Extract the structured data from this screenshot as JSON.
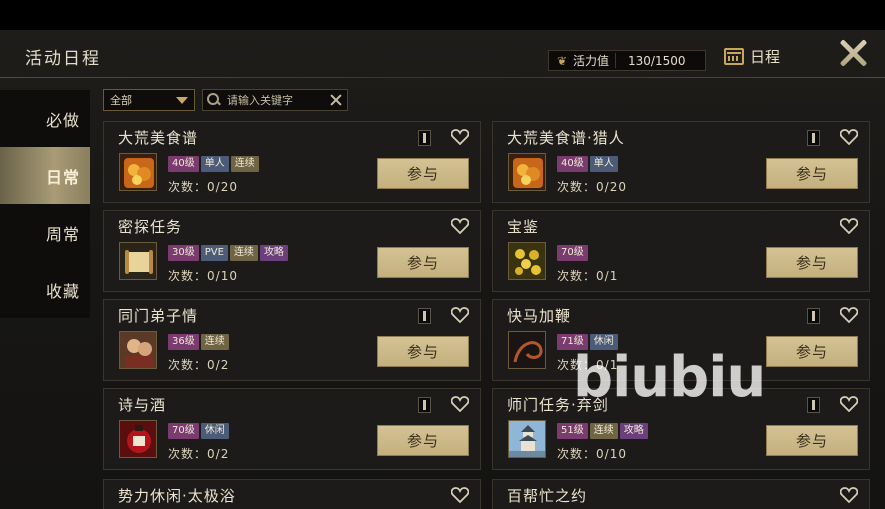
{
  "header": {
    "title": "活动日程",
    "schedule_label": "日程"
  },
  "vitality": {
    "label": "活力值",
    "value": "130/1500"
  },
  "sidebar": {
    "items": [
      {
        "label": "必做",
        "active": false
      },
      {
        "label": "日常",
        "active": true
      },
      {
        "label": "周常",
        "active": false
      },
      {
        "label": "收藏",
        "active": false
      }
    ]
  },
  "filter": {
    "selected": "全部"
  },
  "search": {
    "placeholder": "请输入关键字"
  },
  "activities": [
    {
      "name": "大荒美食谱",
      "tags": [
        "40级",
        "单人",
        "连续"
      ],
      "count_label": "次数：",
      "count": "0/20",
      "join": "参与"
    },
    {
      "name": "大荒美食谱·猎人",
      "tags": [
        "40级",
        "单人"
      ],
      "count_label": "次数：",
      "count": "0/20",
      "join": "参与"
    },
    {
      "name": "密探任务",
      "tags": [
        "30级",
        "PVE",
        "连续",
        "攻略"
      ],
      "count_label": "次数：",
      "count": "0/10",
      "join": "参与"
    },
    {
      "name": "宝鉴",
      "tags": [
        "70级"
      ],
      "count_label": "次数：",
      "count": "0/1",
      "join": "参与"
    },
    {
      "name": "同门弟子情",
      "tags": [
        "36级",
        "连续"
      ],
      "count_label": "次数：",
      "count": "0/2",
      "join": "参与"
    },
    {
      "name": "快马加鞭",
      "tags": [
        "71级",
        "休闲"
      ],
      "count_label": "次数：",
      "count": "0/1",
      "join": "参与"
    },
    {
      "name": "诗与酒",
      "tags": [
        "70级",
        "休闲"
      ],
      "count_label": "次数：",
      "count": "0/2",
      "join": "参与"
    },
    {
      "name": "师门任务·弃剑",
      "tags": [
        "51级",
        "连续",
        "攻略"
      ],
      "count_label": "次数：",
      "count": "0/10",
      "join": "参与"
    }
  ],
  "partial_rows": [
    {
      "name": "势力休闲·太极浴"
    },
    {
      "name": "百帮忙之约"
    }
  ],
  "watermark": "biubiu",
  "colors": {
    "accent_gold": "#c8a65c",
    "join_button": "#d4c294",
    "tag_level": "#7a3c6e",
    "tag_blue": "#4c5c78",
    "tag_gold": "#6f6443",
    "tag_purple": "#6b3f7c"
  },
  "icons": [
    "leaf-icon",
    "calendar-icon",
    "close-icon",
    "search-icon",
    "clear-icon",
    "book-icon",
    "heart-icon",
    "dropdown-chevron-icon"
  ]
}
